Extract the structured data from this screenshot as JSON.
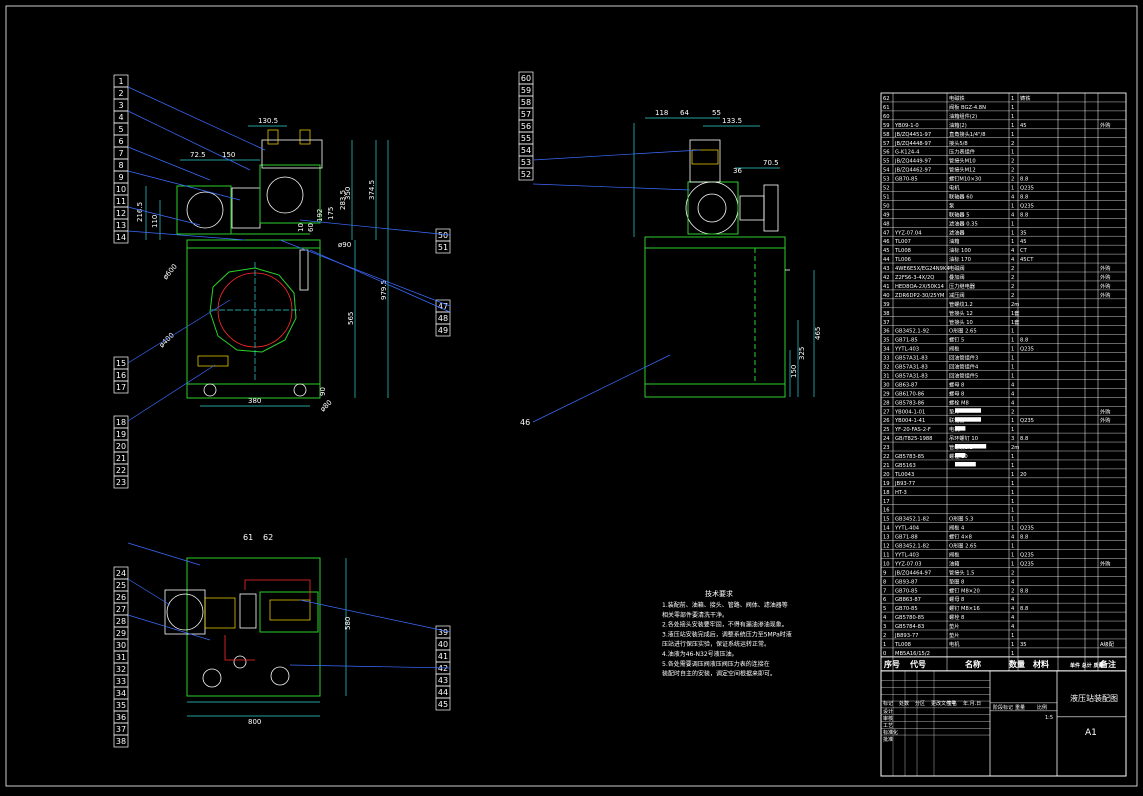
{
  "colors": {
    "bg": "#000000",
    "frame": "#ffffff",
    "dim": "#2fd6d6",
    "body": "#2bd12b",
    "pipe": "#ff2a2a",
    "leader": "#3b6cff",
    "text": "#ffffff",
    "bar": "#ffe000"
  },
  "front_view": {
    "balloons_left": [
      "1",
      "2",
      "3",
      "4",
      "5",
      "6",
      "7",
      "8",
      "9",
      "10",
      "11",
      "12",
      "13",
      "14"
    ],
    "balloons_left2": [
      "15",
      "16",
      "17"
    ],
    "balloons_left3": [
      "18",
      "19",
      "20",
      "21",
      "22",
      "23"
    ],
    "balloons_right": [
      "50",
      "51"
    ],
    "balloons_right2": [
      "47",
      "48",
      "49"
    ],
    "dims": {
      "d1": "130.5",
      "d2": "72.5",
      "d3": "150",
      "d4": "216.5",
      "d5": "110",
      "d6": "350",
      "d7": "374.5",
      "d8": "283.5",
      "d9": "192",
      "d10": "175",
      "d11": "60",
      "d12": "10",
      "d13": "979.5",
      "d14": "565",
      "d15": "380",
      "d16": "90",
      "d17": "ø600",
      "d18": "ø400",
      "d19": "ø90",
      "d20": "ø80"
    }
  },
  "side_view": {
    "balloons": [
      "60",
      "59",
      "58",
      "57",
      "56",
      "55",
      "54",
      "53",
      "52"
    ],
    "balloon_46": "46",
    "dims": {
      "d1": "118",
      "d2": "64",
      "d3": "55",
      "d4": "133.5",
      "d5": "36",
      "d6": "70.5",
      "d7": "325",
      "d8": "465",
      "d9": "150"
    }
  },
  "top_view": {
    "balloons_left": [
      "24",
      "25",
      "26",
      "27",
      "28",
      "29",
      "30",
      "31",
      "32",
      "33",
      "34",
      "35",
      "36",
      "37",
      "38"
    ],
    "balloons_top": [
      "61",
      "62"
    ],
    "balloons_right": [
      "39",
      "40",
      "41",
      "42",
      "43",
      "44",
      "45"
    ],
    "dims": {
      "d1": "580",
      "d2": "800"
    }
  },
  "notes": {
    "title": "技术要求",
    "lines": [
      "1.装配前、油箱、接头、管路、阀体、滤油器等",
      "   相关零部件要清洗干净。",
      "2.各处接头安装要牢固，不得有漏油渗油现象。",
      "3.液压站安装完成后，调整系统压力至5MPa时液",
      "   压站进行保压实验，保证系统运转正常。",
      "4.油液为46-N32号液压油。",
      "5.各处需要调压阀液压阀压力表的连接在",
      "   装配时自主的安装，调定空间根据来即可。"
    ]
  },
  "bom": {
    "rows": [
      [
        "62",
        "",
        "电磁铁",
        "1",
        "铸铁",
        "",
        ""
      ],
      [
        "61",
        "",
        "阀板 BGZ-4.8N",
        "1",
        "",
        "",
        ""
      ],
      [
        "60",
        "",
        "油箱组件(2)",
        "1",
        "",
        "",
        ""
      ],
      [
        "59",
        "YB09-1-0",
        "油箱(2)",
        "1",
        "45",
        "",
        "外购"
      ],
      [
        "58",
        "JB/ZQ4451-97",
        "直角接头1/4\"/8",
        "1",
        "",
        "",
        ""
      ],
      [
        "57",
        "JB/ZQ4448-97",
        "接头5/8",
        "2",
        "",
        "",
        ""
      ],
      [
        "56",
        "G-K124-4",
        "压力表组件",
        "1",
        "",
        "",
        ""
      ],
      [
        "55",
        "JB/ZQ4449-97",
        "管接头M10",
        "2",
        "",
        "",
        ""
      ],
      [
        "54",
        "JB/ZQ4462-97",
        "管接头M12",
        "2",
        "",
        "",
        ""
      ],
      [
        "53",
        "GB70-85",
        "螺钉M10×30",
        "2",
        "8.8",
        "",
        ""
      ],
      [
        "52",
        "",
        "电机",
        "1",
        "Q235",
        "",
        ""
      ],
      [
        "51",
        "",
        "联轴器 60",
        "4",
        "8.8",
        "",
        ""
      ],
      [
        "50",
        "",
        "泵",
        "1",
        "Q235",
        "",
        ""
      ],
      [
        "49",
        "",
        "联轴器 5",
        "4",
        "8.8",
        "",
        ""
      ],
      [
        "48",
        "",
        "滤油器 0.35",
        "1",
        "",
        "",
        ""
      ],
      [
        "47",
        "YYZ-07.04",
        "滤油器",
        "1",
        "35",
        "",
        ""
      ],
      [
        "46",
        "TL007",
        "油箱",
        "1",
        "45",
        "",
        ""
      ],
      [
        "45",
        "TL008",
        "油标 100",
        "4",
        "CT",
        "",
        ""
      ],
      [
        "44",
        "TL006",
        "油标 170",
        "4",
        "45CT",
        "",
        ""
      ],
      [
        "43",
        "4WE6E5X/EG24N9K4",
        "电磁阀",
        "2",
        "",
        "",
        "外购"
      ],
      [
        "42",
        "Z2FS6-3-4X/2Q",
        "叠加阀",
        "2",
        "",
        "",
        "外购"
      ],
      [
        "41",
        "HED8OA-2X/50K14",
        "压力继电器",
        "2",
        "",
        "",
        "外购"
      ],
      [
        "40",
        "ZDR6DP2-30/25YM",
        "减压阀",
        "2",
        "",
        "",
        "外购"
      ],
      [
        "39",
        "",
        "管螺纹1.2",
        "2m",
        "",
        "",
        ""
      ],
      [
        "38",
        "",
        "管接头 12",
        "1套",
        "",
        "",
        ""
      ],
      [
        "37",
        "",
        "管接头 10",
        "1套",
        "",
        "",
        ""
      ],
      [
        "36",
        "GB3452.1-92",
        "O形圈 2.65",
        "1",
        "",
        "",
        ""
      ],
      [
        "35",
        "GB71-85",
        "螺钉 5",
        "1",
        "8.8",
        "",
        ""
      ],
      [
        "34",
        "YYTL-403",
        "阀板",
        "1",
        "Q235",
        "",
        ""
      ],
      [
        "33",
        "GB57A31-83",
        "回油管组件3",
        "1",
        "",
        "",
        ""
      ],
      [
        "32",
        "GB57A31-83",
        "回油管组件4",
        "1",
        "",
        "",
        ""
      ],
      [
        "31",
        "GB57A31-83",
        "回油管组件5",
        "1",
        "",
        "",
        ""
      ],
      [
        "30",
        "GB63-87",
        "螺母 8",
        "4",
        "",
        "",
        ""
      ],
      [
        "29",
        "GB6170-86",
        "螺母 8",
        "4",
        "",
        "",
        ""
      ],
      [
        "28",
        "GB5783-86",
        "螺栓 M8",
        "4",
        "",
        "",
        ""
      ],
      [
        "27",
        "YB004-1-01",
        "垫片",
        "2",
        "",
        "",
        "外购"
      ],
      [
        "26",
        "YB004-1-41",
        "联轴器",
        "1",
        "Q235",
        "",
        "外购"
      ],
      [
        "25",
        "YF-20-FAS-2-F",
        "电机",
        "1",
        "",
        "",
        ""
      ],
      [
        "24",
        "GB/T825-1988",
        "吊环螺钉 10",
        "3",
        "8.8",
        "",
        ""
      ],
      [
        "23",
        "",
        "管螺纹1.2",
        "2m",
        "",
        "",
        ""
      ],
      [
        "22",
        "GB5783-85",
        "螺栓 10",
        "1",
        "",
        "",
        ""
      ],
      [
        "21",
        "GB5163",
        "",
        "1",
        "",
        "",
        ""
      ],
      [
        "20",
        "TL0043",
        "",
        "1",
        "20",
        "",
        ""
      ],
      [
        "19",
        "JB93-77",
        "",
        "1",
        "",
        "",
        ""
      ],
      [
        "18",
        "HT-3",
        "",
        "1",
        "",
        "",
        ""
      ],
      [
        "17",
        "",
        "",
        "1",
        "",
        "",
        ""
      ],
      [
        "16",
        "",
        "",
        "1",
        "",
        "",
        ""
      ],
      [
        "15",
        "GB3452.1-82",
        "O形圈 5.3",
        "1",
        "",
        "",
        ""
      ],
      [
        "14",
        "YYTL-404",
        "阀板 4",
        "1",
        "Q235",
        "",
        ""
      ],
      [
        "13",
        "GB71-88",
        "螺钉 4×8",
        "4",
        "8.8",
        "",
        ""
      ],
      [
        "12",
        "GB3452.1-82",
        "O形圈 2.65",
        "1",
        "",
        "",
        ""
      ],
      [
        "11",
        "YYTL-403",
        "阀板",
        "1",
        "Q235",
        "",
        ""
      ],
      [
        "10",
        "YYZ-07.03",
        "油箱",
        "1",
        "Q235",
        "",
        "外购"
      ],
      [
        "9",
        "JB/ZQ4464-97",
        "管接头 1.5",
        "2",
        "",
        "",
        ""
      ],
      [
        "8",
        "GB93-87",
        "垫圈 8",
        "4",
        "",
        "",
        ""
      ],
      [
        "7",
        "GB70-85",
        "螺钉 M8×20",
        "2",
        "8.8",
        "",
        ""
      ],
      [
        "6",
        "GB863-87",
        "螺母 8",
        "4",
        "",
        "",
        ""
      ],
      [
        "5",
        "GB70-85",
        "螺钉 M8×16",
        "4",
        "8.8",
        "",
        ""
      ],
      [
        "4",
        "GB5780-85",
        "螺栓 8",
        "4",
        "",
        "",
        ""
      ],
      [
        "3",
        "GB5784-83",
        "垫片",
        "4",
        "",
        "",
        ""
      ],
      [
        "2",
        "JB893-77",
        "垫片",
        "1",
        "",
        "",
        ""
      ],
      [
        "1",
        "TL008",
        "电机",
        "1",
        "35",
        "",
        "A级配"
      ],
      [
        "0",
        "MB5A16/15/2",
        "",
        "1",
        "",
        "",
        ""
      ]
    ],
    "headers": [
      "序号",
      "代号",
      "名称",
      "数量",
      "材料",
      "单件 总计 质量",
      "备注"
    ]
  },
  "title_block": {
    "drawing_name": "液压站装配图",
    "sheet_size": "A1",
    "rev_labels": [
      "标记",
      "处数",
      "分区",
      "更改文件号",
      "签名",
      "年.月.日"
    ],
    "role_labels": [
      "设计",
      "审核",
      "工艺",
      "标准化",
      "批准"
    ],
    "stage_labels": [
      "阶段标记",
      "重量",
      "比例"
    ],
    "scale_value": "1:5"
  }
}
